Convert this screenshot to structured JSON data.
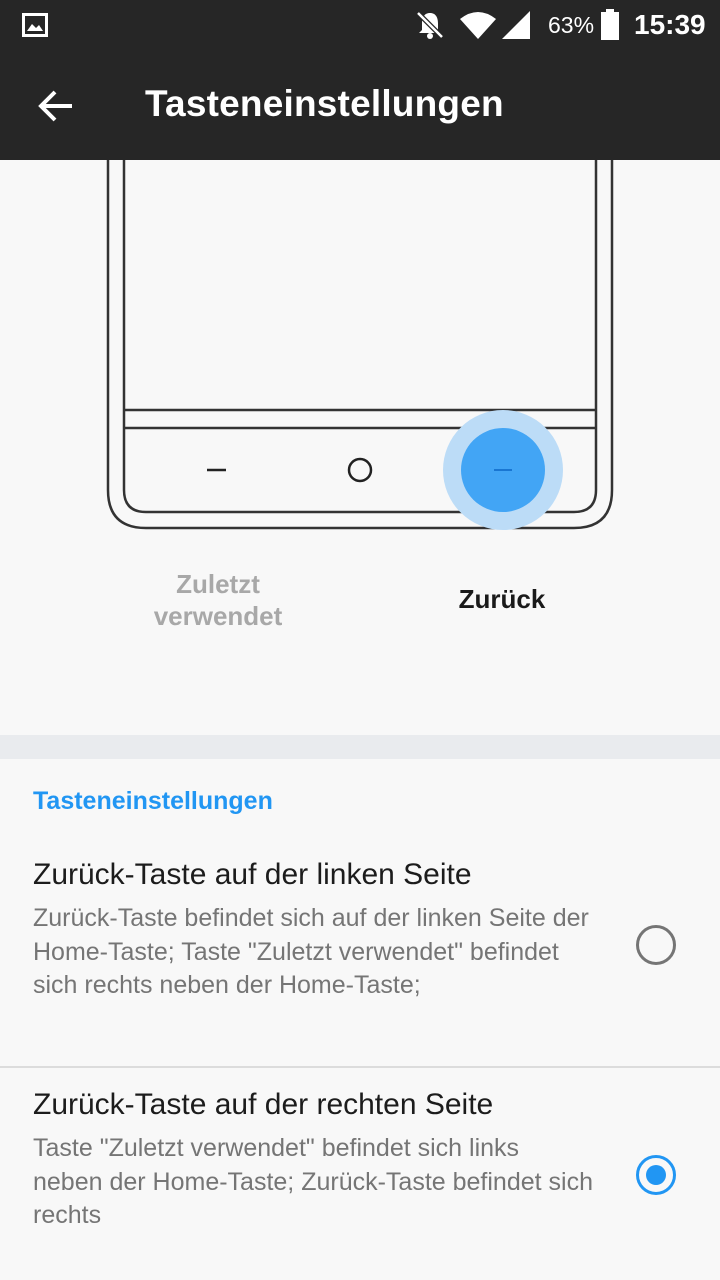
{
  "status_bar": {
    "battery": "63%",
    "time": "15:39",
    "icons": [
      "gallery-icon",
      "bell-off-icon",
      "wifi-icon",
      "signal-icon",
      "battery-icon"
    ]
  },
  "toolbar": {
    "title": "Tasteneinstellungen",
    "back_icon": "arrow-left-icon"
  },
  "illustration": {
    "recent_label": "Zuletzt\nverwendet",
    "back_label": "Zurück",
    "highlight_color": "#42a5f5"
  },
  "section": {
    "header": "Tasteneinstellungen",
    "options": [
      {
        "title": "Zurück-Taste auf der linken Seite",
        "description": "Zurück-Taste befindet sich auf der linken Seite der Home-Taste; Taste \"Zuletzt verwendet\" befindet sich rechts neben der Home-Taste;",
        "selected": false
      },
      {
        "title": "Zurück-Taste auf der rechten Seite",
        "description": "Taste \"Zuletzt verwendet\" befindet sich links neben der Home-Taste; Zurück-Taste befindet sich rechts",
        "selected": true
      }
    ]
  },
  "colors": {
    "accent": "#2196f3",
    "bar": "#262626",
    "background": "#f8f8f8"
  }
}
